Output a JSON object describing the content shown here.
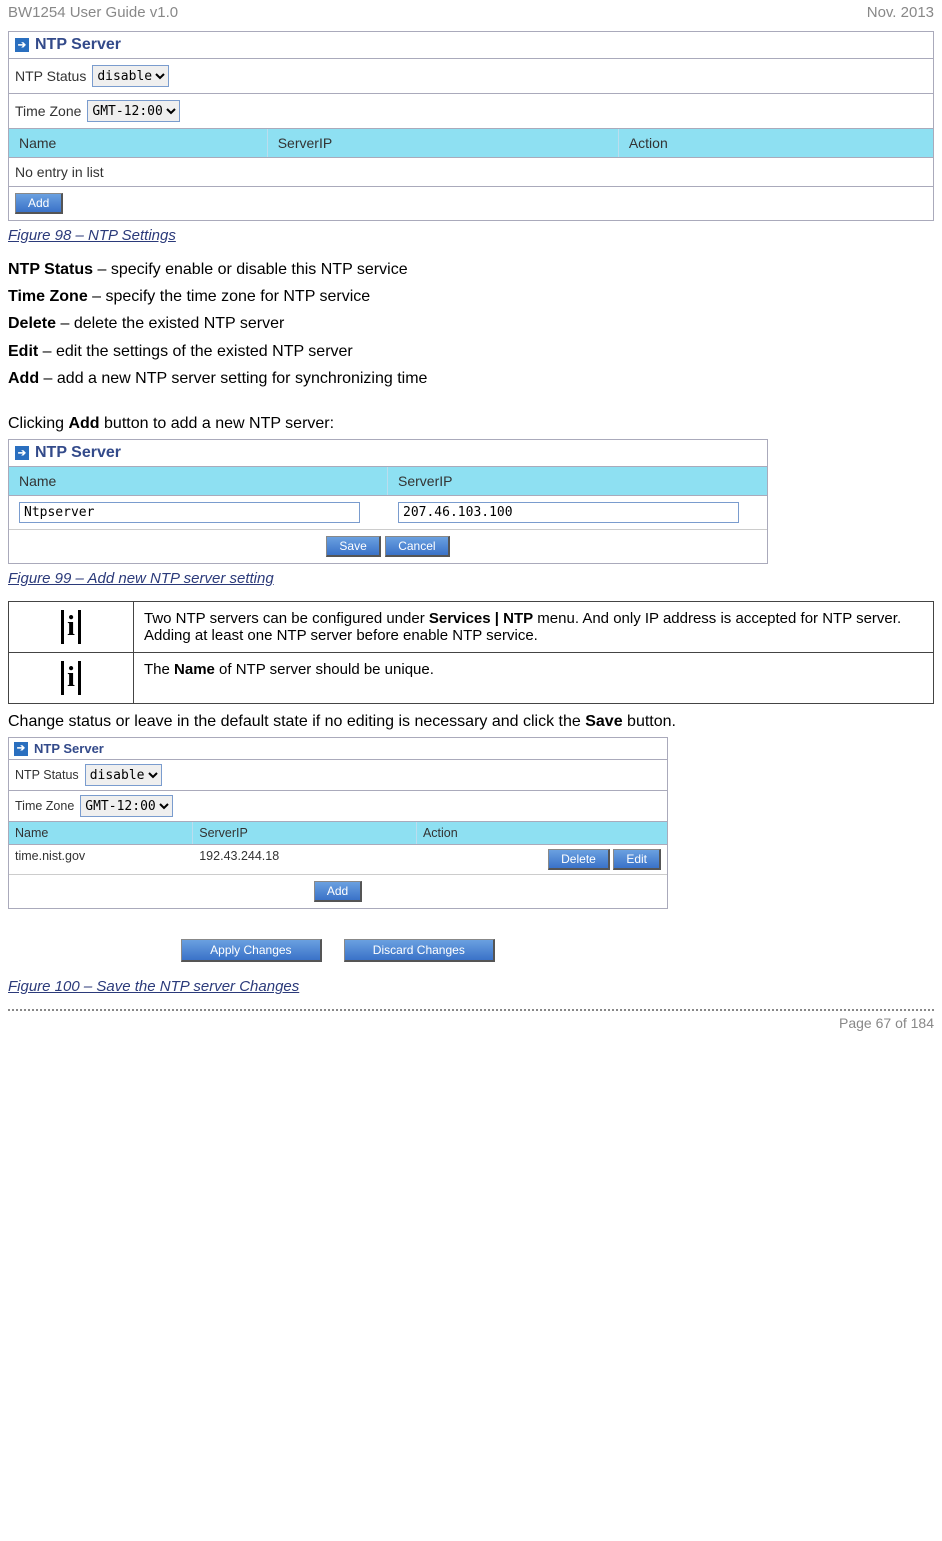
{
  "header": {
    "left": "BW1254 User Guide v1.0",
    "right": "Nov.  2013"
  },
  "panel1": {
    "title": "NTP Server",
    "row_ntp_label": "NTP Status",
    "row_ntp_value": "disable",
    "row_tz_label": "Time Zone",
    "row_tz_value": "GMT-12:00",
    "th_name": "Name",
    "th_serverip": "ServerIP",
    "th_action": "Action",
    "empty": "No entry in list",
    "add_btn": "Add"
  },
  "fig98": "Figure 98 – NTP Settings",
  "desc": {
    "ntp_status_b": "NTP Status",
    "ntp_status_t": " – specify enable or disable this NTP service",
    "tz_b": "Time Zone",
    "tz_t": " – specify the time zone for NTP service",
    "del_b": "Delete",
    "del_t": " – delete the existed NTP server",
    "edit_b": "Edit",
    "edit_t": " – edit the settings of the existed NTP server",
    "add_b": "Add",
    "add_t": " – add a new NTP server setting for synchronizing time"
  },
  "click_add_pre": "Clicking ",
  "click_add_b": "Add",
  "click_add_post": " button to add a new NTP server:",
  "panel2": {
    "title": "NTP Server",
    "th_name": "Name",
    "th_serverip": "ServerIP",
    "name_val": "Ntpserver",
    "ip_val": "207.46.103.100",
    "save_btn": "Save",
    "cancel_btn": "Cancel"
  },
  "fig99": "Figure 99 – Add new NTP server setting",
  "info1_a": "Two NTP servers can be configured under ",
  "info1_b": "Services | NTP",
  "info1_c": "  menu. And only IP address is accepted for NTP server.",
  "info1_d": "Adding at least one NTP server before enable NTP service.",
  "info2_a": "The ",
  "info2_b": "Name",
  "info2_c": " of NTP server should be unique.",
  "change_pre": "Change status or leave in the default state if no editing is necessary and click the ",
  "change_b": "Save",
  "change_post": " button.",
  "panel3": {
    "title": "NTP Server",
    "row_ntp_label": "NTP Status",
    "row_ntp_value": "disable",
    "row_tz_label": "Time Zone",
    "row_tz_value": "GMT-12:00",
    "th_name": "Name",
    "th_serverip": "ServerIP",
    "th_action": "Action",
    "name": "time.nist.gov",
    "ip": "192.43.244.18",
    "del_btn": "Delete",
    "edit_btn": "Edit",
    "add_btn": "Add",
    "apply_btn": "Apply Changes",
    "discard_btn": "Discard Changes"
  },
  "fig100": "Figure 100 – Save the NTP server Changes",
  "footer": "Page 67 of 184"
}
